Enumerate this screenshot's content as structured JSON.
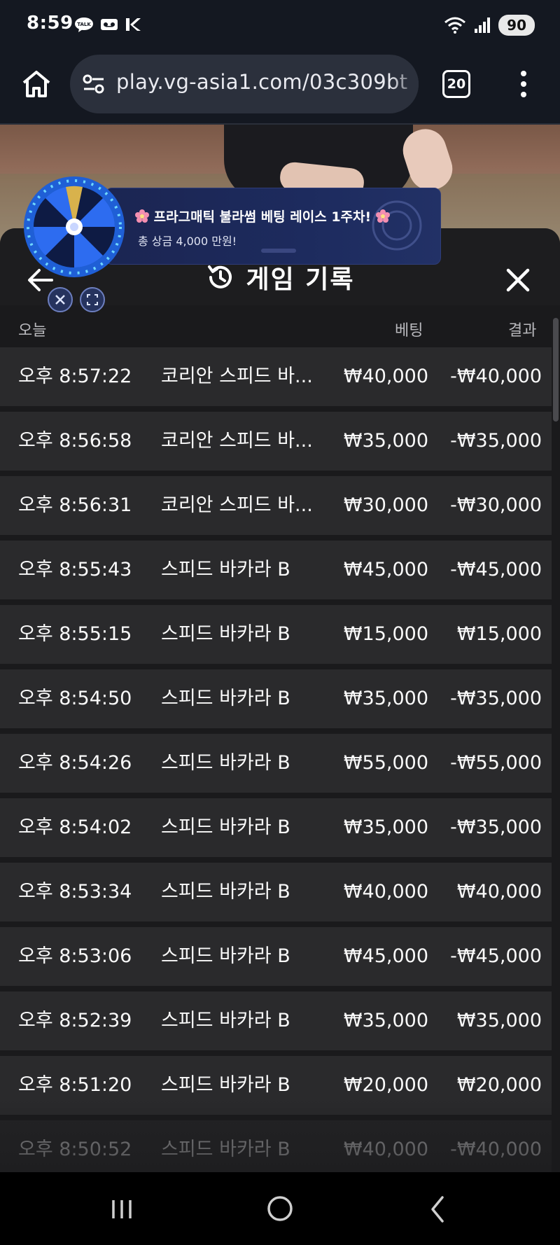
{
  "status_bar": {
    "time": "8:59",
    "battery": "90",
    "icons": [
      "talk-icon",
      "voicemail-icon",
      "k-app-icon",
      "wifi-icon",
      "signal-icon",
      "battery-icon"
    ]
  },
  "browser": {
    "url": "play.vg-asia1.com/03c309bt",
    "tab_count": "20",
    "icons": [
      "home-icon",
      "site-settings-icon",
      "tabs-icon",
      "menu-icon"
    ]
  },
  "promo": {
    "title": "프라그매틱 불라썸 베팅 레이스 1주차!",
    "subtitle": "총 상금 4,000 만원!"
  },
  "history": {
    "title": "게임 기록",
    "columns": {
      "date": "오늘",
      "bet": "베팅",
      "result": "결과"
    },
    "rows": [
      {
        "time": "오후 8:57:22",
        "game": "코리안 스피드 바...",
        "bet": "₩40,000",
        "result": "-₩40,000"
      },
      {
        "time": "오후 8:56:58",
        "game": "코리안 스피드 바...",
        "bet": "₩35,000",
        "result": "-₩35,000"
      },
      {
        "time": "오후 8:56:31",
        "game": "코리안 스피드 바...",
        "bet": "₩30,000",
        "result": "-₩30,000"
      },
      {
        "time": "오후 8:55:43",
        "game": "스피드 바카라 B",
        "bet": "₩45,000",
        "result": "-₩45,000"
      },
      {
        "time": "오후 8:55:15",
        "game": "스피드 바카라 B",
        "bet": "₩15,000",
        "result": "₩15,000"
      },
      {
        "time": "오후 8:54:50",
        "game": "스피드 바카라 B",
        "bet": "₩35,000",
        "result": "-₩35,000"
      },
      {
        "time": "오후 8:54:26",
        "game": "스피드 바카라 B",
        "bet": "₩55,000",
        "result": "-₩55,000"
      },
      {
        "time": "오후 8:54:02",
        "game": "스피드 바카라 B",
        "bet": "₩35,000",
        "result": "-₩35,000"
      },
      {
        "time": "오후 8:53:34",
        "game": "스피드 바카라 B",
        "bet": "₩40,000",
        "result": "₩40,000"
      },
      {
        "time": "오후 8:53:06",
        "game": "스피드 바카라 B",
        "bet": "₩45,000",
        "result": "-₩45,000"
      },
      {
        "time": "오후 8:52:39",
        "game": "스피드 바카라 B",
        "bet": "₩35,000",
        "result": "₩35,000"
      },
      {
        "time": "오후 8:51:20",
        "game": "스피드 바카라 B",
        "bet": "₩20,000",
        "result": "₩20,000"
      },
      {
        "time": "오후 8:50:52",
        "game": "스피드 바카라 B",
        "bet": "₩40,000",
        "result": "-₩40,000"
      }
    ]
  },
  "nav": {
    "icons": [
      "recent-apps-icon",
      "home-nav-icon",
      "back-nav-icon"
    ]
  },
  "colors": {
    "sheet_bg": "#1a1a1c",
    "row_bg": "#2a2a2c",
    "promo_bg": "#1d2b5e",
    "browser_bg": "#141821"
  }
}
